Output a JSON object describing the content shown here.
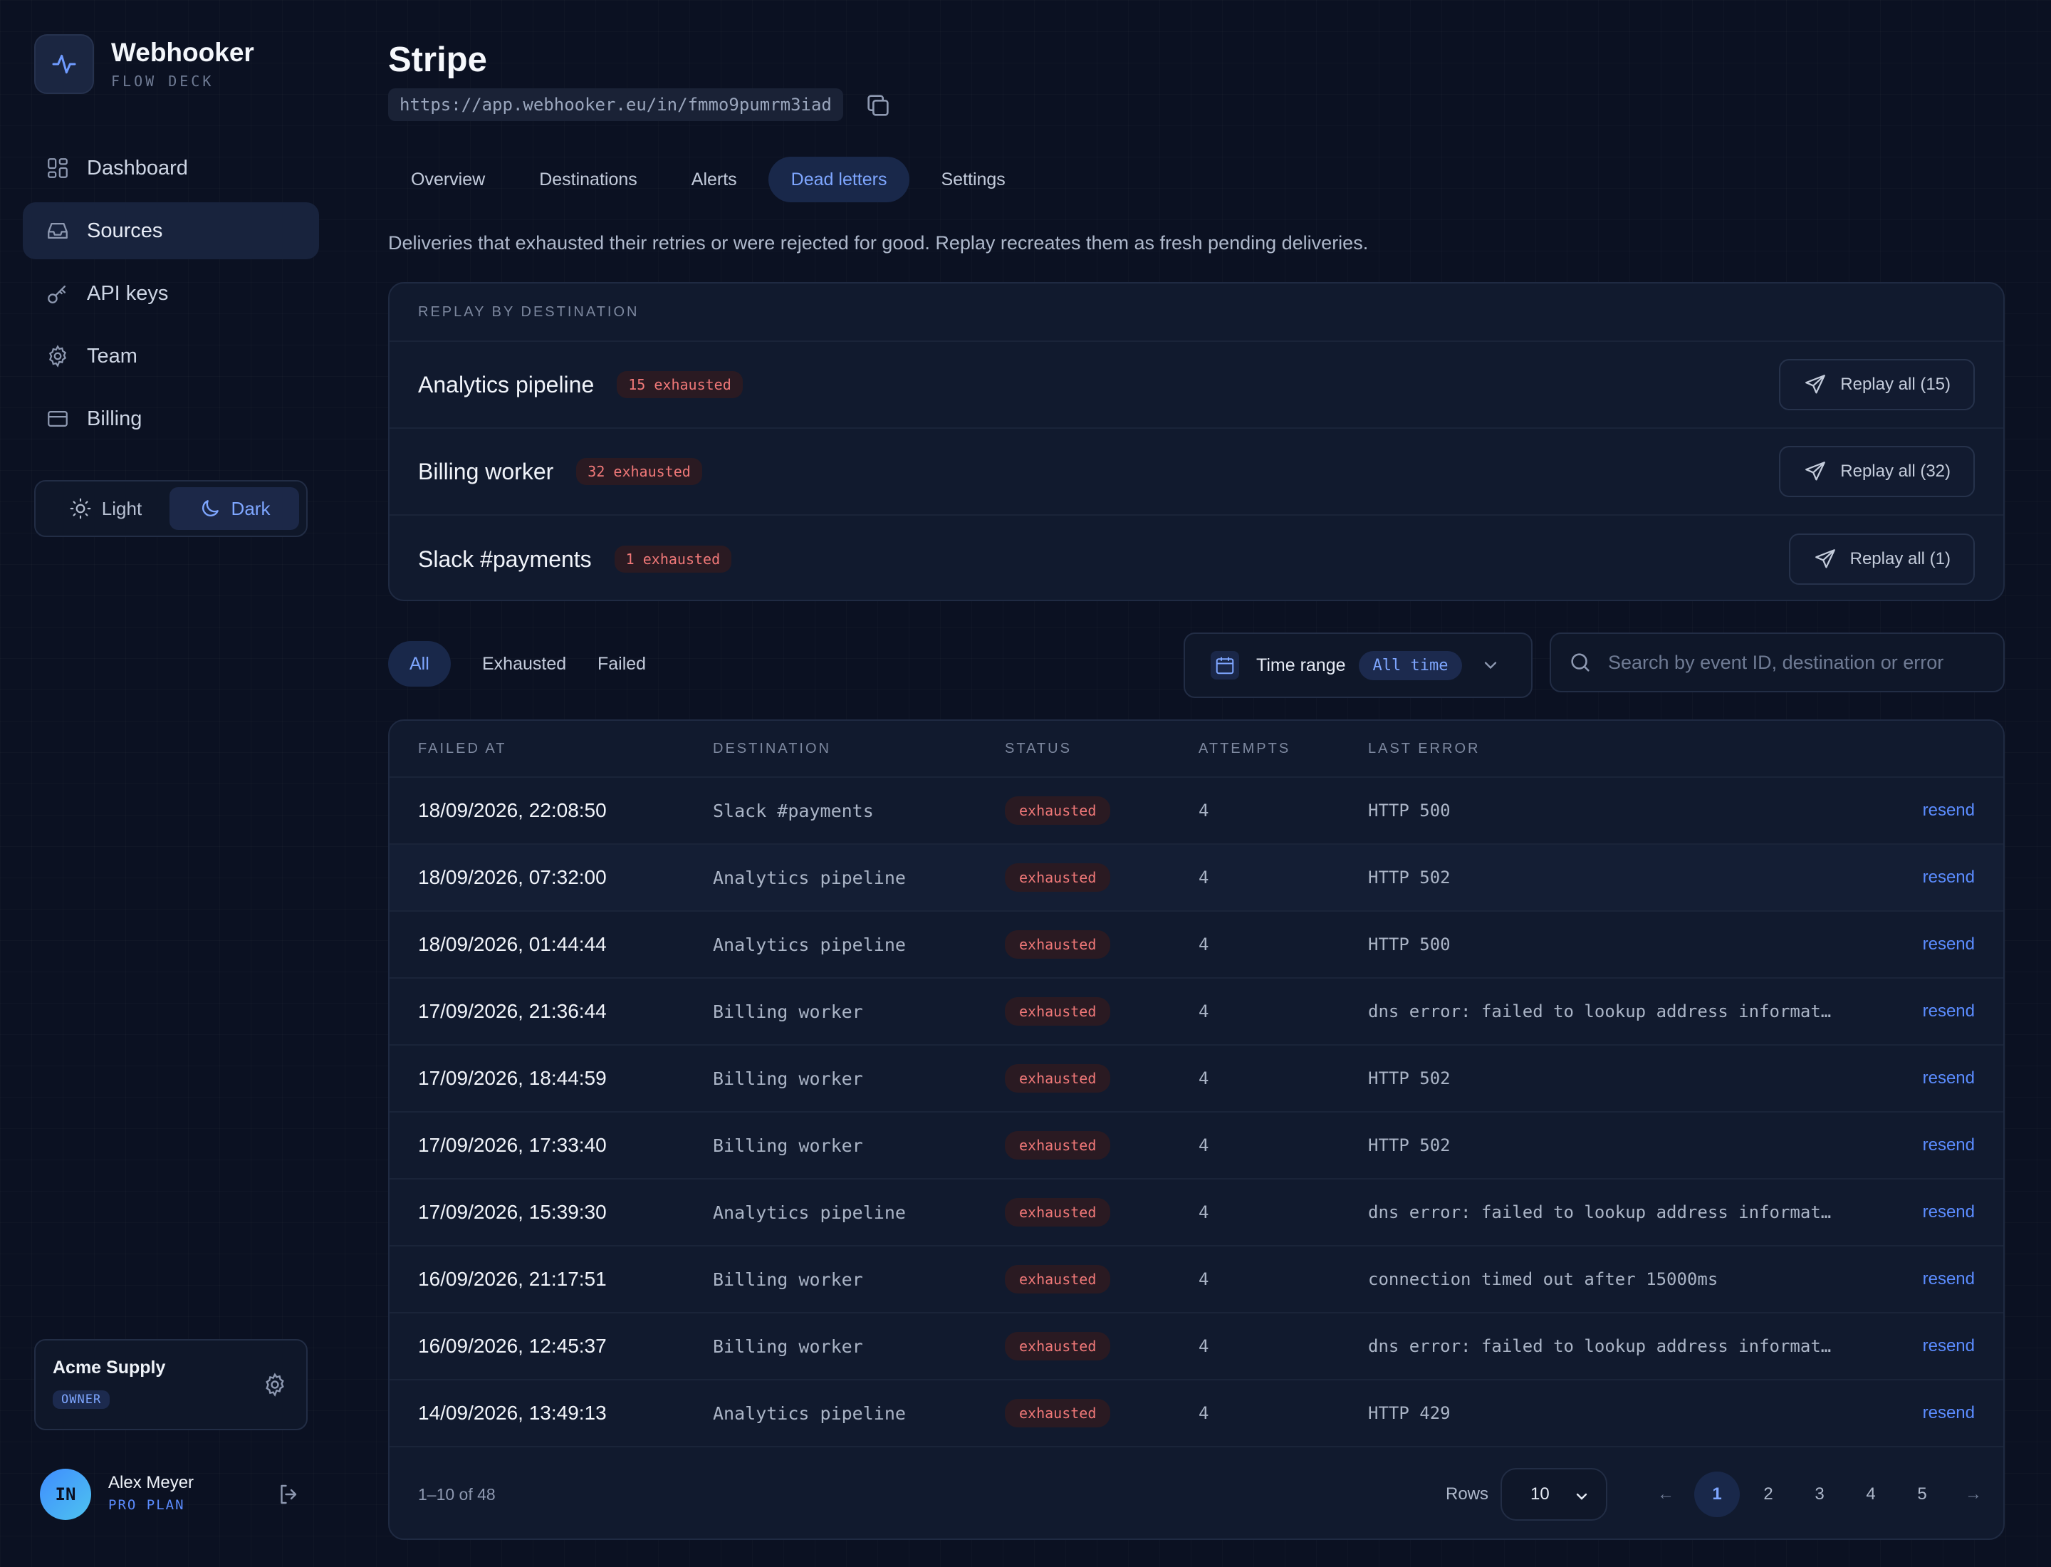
{
  "brand": {
    "name": "Webhooker",
    "subtitle": "FLOW DECK"
  },
  "sidebar": {
    "items": [
      {
        "label": "Dashboard",
        "icon": "dashboard-icon",
        "active": false
      },
      {
        "label": "Sources",
        "icon": "inbox-icon",
        "active": true
      },
      {
        "label": "API keys",
        "icon": "key-icon",
        "active": false
      },
      {
        "label": "Team",
        "icon": "gear-icon",
        "active": false
      },
      {
        "label": "Billing",
        "icon": "card-icon",
        "active": false
      }
    ],
    "theme": {
      "light": "Light",
      "dark": "Dark",
      "selected": "Dark"
    }
  },
  "org": {
    "name": "Acme Supply",
    "role": "OWNER"
  },
  "user": {
    "initials": "IN",
    "name": "Alex Meyer",
    "plan": "PRO PLAN"
  },
  "page": {
    "title": "Stripe",
    "url": "https://app.webhooker.eu/in/fmmo9pumrm3iad",
    "tabs": [
      "Overview",
      "Destinations",
      "Alerts",
      "Dead letters",
      "Settings"
    ],
    "active_tab": "Dead letters",
    "description": "Deliveries that exhausted their retries or were rejected for good. Replay recreates them as fresh pending deliveries."
  },
  "replay": {
    "heading": "REPLAY BY DESTINATION",
    "rows": [
      {
        "name": "Analytics pipeline",
        "badge": "15 exhausted",
        "button": "Replay all (15)"
      },
      {
        "name": "Billing worker",
        "badge": "32 exhausted",
        "button": "Replay all (32)"
      },
      {
        "name": "Slack #payments",
        "badge": "1 exhausted",
        "button": "Replay all (1)"
      }
    ]
  },
  "filters": {
    "tabs": [
      "All",
      "Exhausted",
      "Failed"
    ],
    "active": "All",
    "time_range_label": "Time range",
    "time_range_value": "All time",
    "search_placeholder": "Search by event ID, destination or error"
  },
  "table": {
    "columns": [
      "FAILED AT",
      "DESTINATION",
      "STATUS",
      "ATTEMPTS",
      "LAST ERROR"
    ],
    "rows": [
      {
        "failed_at": "18/09/2026, 22:08:50",
        "destination": "Slack #payments",
        "status": "exhausted",
        "attempts": "4",
        "error": "HTTP 500",
        "action": "resend"
      },
      {
        "failed_at": "18/09/2026, 07:32:00",
        "destination": "Analytics pipeline",
        "status": "exhausted",
        "attempts": "4",
        "error": "HTTP 502",
        "action": "resend"
      },
      {
        "failed_at": "18/09/2026, 01:44:44",
        "destination": "Analytics pipeline",
        "status": "exhausted",
        "attempts": "4",
        "error": "HTTP 500",
        "action": "resend"
      },
      {
        "failed_at": "17/09/2026, 21:36:44",
        "destination": "Billing worker",
        "status": "exhausted",
        "attempts": "4",
        "error": "dns error: failed to lookup address informat…",
        "action": "resend"
      },
      {
        "failed_at": "17/09/2026, 18:44:59",
        "destination": "Billing worker",
        "status": "exhausted",
        "attempts": "4",
        "error": "HTTP 502",
        "action": "resend"
      },
      {
        "failed_at": "17/09/2026, 17:33:40",
        "destination": "Billing worker",
        "status": "exhausted",
        "attempts": "4",
        "error": "HTTP 502",
        "action": "resend"
      },
      {
        "failed_at": "17/09/2026, 15:39:30",
        "destination": "Analytics pipeline",
        "status": "exhausted",
        "attempts": "4",
        "error": "dns error: failed to lookup address informat…",
        "action": "resend"
      },
      {
        "failed_at": "16/09/2026, 21:17:51",
        "destination": "Billing worker",
        "status": "exhausted",
        "attempts": "4",
        "error": "connection timed out after 15000ms",
        "action": "resend"
      },
      {
        "failed_at": "16/09/2026, 12:45:37",
        "destination": "Billing worker",
        "status": "exhausted",
        "attempts": "4",
        "error": "dns error: failed to lookup address informat…",
        "action": "resend"
      },
      {
        "failed_at": "14/09/2026, 13:49:13",
        "destination": "Analytics pipeline",
        "status": "exhausted",
        "attempts": "4",
        "error": "HTTP 429",
        "action": "resend"
      }
    ],
    "footer": {
      "count": "1–10 of 48",
      "rows_label": "Rows",
      "rows_value": "10",
      "pages": [
        "1",
        "2",
        "3",
        "4",
        "5"
      ],
      "current_page": "1",
      "prev": "←",
      "next": "→"
    }
  },
  "colors": {
    "background": "#0b1122",
    "accent": "#7ea6ff",
    "danger": "#f07878",
    "link": "#5b8cff"
  }
}
